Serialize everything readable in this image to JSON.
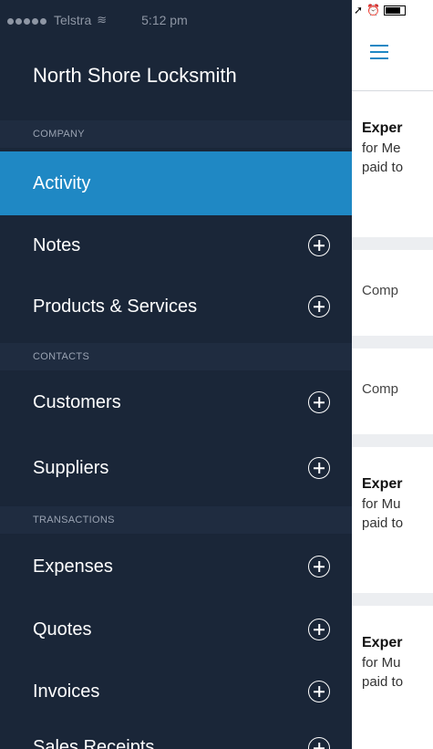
{
  "status": {
    "carrier": "Telstra",
    "time": "5:12 pm"
  },
  "brand": "North Shore Locksmith",
  "sections": {
    "company": "COMPANY",
    "contacts": "CONTACTS",
    "transactions": "TRANSACTIONS"
  },
  "menu": {
    "activity": "Activity",
    "notes": "Notes",
    "products": "Products & Services",
    "customers": "Customers",
    "suppliers": "Suppliers",
    "expenses": "Expenses",
    "quotes": "Quotes",
    "invoices": "Invoices",
    "sales_receipts": "Sales Receipts"
  },
  "colors": {
    "drawer": "#1a2638",
    "active": "#1f88c4",
    "section": "#1f2c40"
  },
  "content": {
    "card1": {
      "title": "Exper",
      "line1": "for Me",
      "line2": "paid to"
    },
    "card2": {
      "text": "Comp"
    },
    "card3": {
      "text": "Comp"
    },
    "card4": {
      "title": "Exper",
      "line1": "for Mu",
      "line2": "paid to"
    },
    "card5": {
      "title": "Exper",
      "line1": "for Mu",
      "line2": "paid to"
    }
  }
}
